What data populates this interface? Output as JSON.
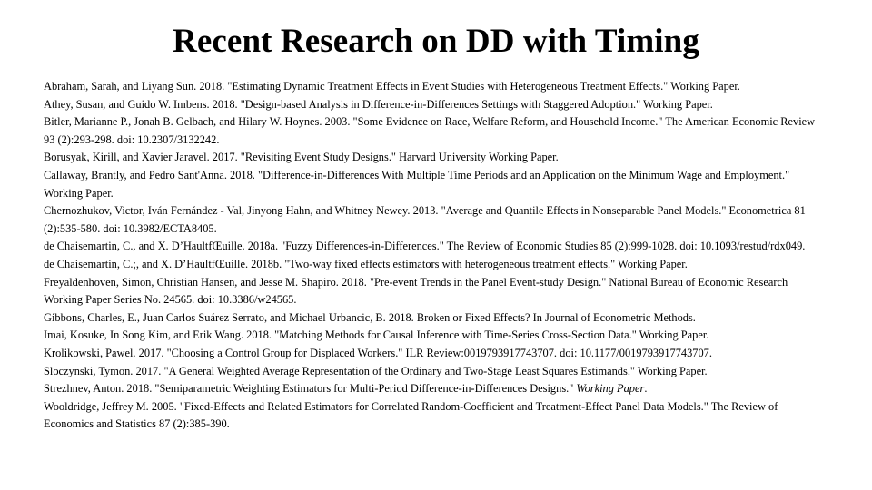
{
  "slide": {
    "title": "Recent Research on DD with Timing",
    "background_color": "#ffffff",
    "text_color": "#000000"
  },
  "references": [
    {
      "id": "ref-abraham-sun-2018",
      "text": "Abraham, Sarah, and Liyang Sun. 2018. \"Estimating Dynamic Treatment Effects in Event Studies with Heterogeneous Treatment Effects.\"  Working Paper."
    },
    {
      "id": "ref-athey-imbens-2018",
      "text": "Athey, Susan, and Guido W. Imbens. 2018. \"Design-based Analysis in Difference-in-Differences Settings with Staggered Adoption.\"  Working Paper."
    },
    {
      "id": "ref-bitler-gelbach-hoynes-2003",
      "text": "Bitler, Marianne P., Jonah B. Gelbach, and Hilary W. Hoynes. 2003. \"Some Evidence on Race, Welfare Reform, and Household Income.\"  The American Economic Review 93 (2):293-298. doi: 10.2307/3132242."
    },
    {
      "id": "ref-borusyak-jaravel-2017",
      "text": "Borusyak, Kirill, and Xavier Jaravel. 2017. \"Revisiting Event Study Designs.\"  Harvard University Working Paper."
    },
    {
      "id": "ref-callaway-santanna-2018",
      "text": "Callaway, Brantly, and Pedro Sant'Anna. 2018. \"Difference-in-Differences With Multiple Time Periods and an Application on the Minimum Wage and Employment.\"  Working Paper."
    },
    {
      "id": "ref-chernozhukov-2013",
      "text": "Chernozhukov, Victor, Iván Fernández - Val, Jinyong Hahn, and Whitney Newey. 2013. \"Average and Quantile Effects in Nonseparable Panel Models.\"  Econometrica 81 (2):535-580. doi: 10.3982/ECTA8405."
    },
    {
      "id": "ref-dechaisemartin-2018a",
      "text": "de Chaisemartin, C., and X. D’HaultfŒuille. 2018a. \"Fuzzy Differences-in-Differences.\"  The Review of Economic Studies 85 (2):999-1028. doi: 10.1093/restud/rdx049."
    },
    {
      "id": "ref-dechaisemartin-2018b",
      "text": "de Chaisemartin, C.;, and X. D’HaultfŒuille. 2018b. \"Two-way fixed effects estimators with heterogeneous treatment effects.\"  Working Paper."
    },
    {
      "id": "ref-freyaldenhoven-2018",
      "text": "Freyaldenhoven, Simon, Christian Hansen, and Jesse M. Shapiro. 2018. \"Pre-event Trends in the Panel Event-study Design.\"  National Bureau of Economic Research Working Paper Series No. 24565. doi: 10.3386/w24565."
    },
    {
      "id": "ref-gibbons-2018",
      "text": "Gibbons, Charles, E., Juan Carlos Suárez Serrato, and Michael Urbancic, B. 2018. Broken or Fixed Effects? In Journal of Econometric Methods."
    },
    {
      "id": "ref-imai-2018",
      "text": "Imai, Kosuke, In Song Kim, and Erik Wang. 2018. \"Matching Methods for Causal Inference with Time-Series Cross-Section Data.\"  Working Paper."
    },
    {
      "id": "ref-krolikowski-2017",
      "text": "Krolikowski, Pawel. 2017. \"Choosing a Control Group for Displaced Workers.\"  ILR Review:0019793917743707. doi: 10.1177/0019793917743707."
    },
    {
      "id": "ref-sloczynski-2017",
      "text": "Sloczynski, Tymon. 2017. \"A General Weighted Average Representation of the Ordinary and Two-Stage Least Squares Estimands.\"  Working Paper."
    },
    {
      "id": "ref-strezhnev-2018",
      "text": "Strezhnev, Anton. 2018. \"Semiparametric Weighting Estimators for Multi-Period Difference-in-Differences Designs.\"  ",
      "italic_text": "Working Paper",
      "text_after": "."
    },
    {
      "id": "ref-wooldridge-2005",
      "text": "Wooldridge, Jeffrey M. 2005. \"Fixed-Effects and Related Estimators for Correlated Random-Coefficient and Treatment-Effect Panel Data Models.\"  The Review of Economics and Statistics 87 (2):385-390."
    }
  ]
}
